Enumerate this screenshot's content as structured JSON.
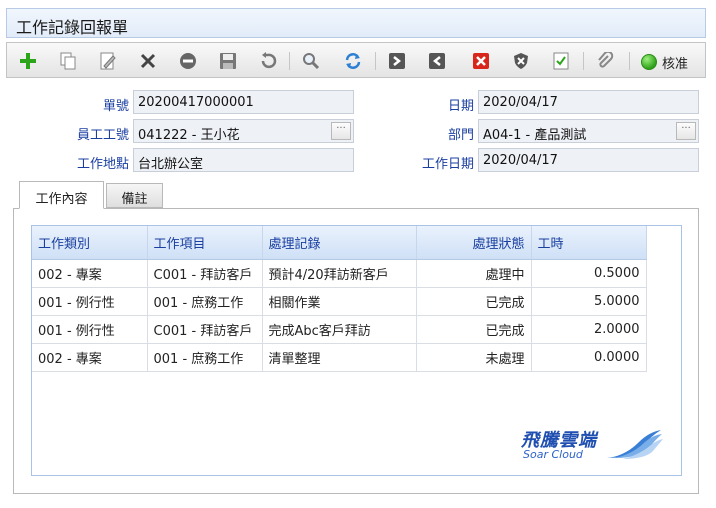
{
  "window": {
    "title": "工作記錄回報單"
  },
  "toolbar": {
    "icons": [
      "add-icon",
      "copy-icon",
      "edit-icon",
      "delete-icon",
      "cancel-icon",
      "save-icon",
      "undo-icon",
      "search-icon",
      "refresh-icon",
      "next-icon",
      "previous-icon",
      "close-icon",
      "shield-icon",
      "checklist-icon",
      "attachment-icon"
    ],
    "approve_label": "核准"
  },
  "form": {
    "doc_no": {
      "label": "單號",
      "value": "20200417000001"
    },
    "date": {
      "label": "日期",
      "value": "2020/04/17"
    },
    "employee": {
      "label": "員工工號",
      "value": "041222 - 王小花"
    },
    "department": {
      "label": "部門",
      "value": "A04-1 - 產品測試"
    },
    "location": {
      "label": "工作地點",
      "value": "台北辦公室"
    },
    "work_date": {
      "label": "工作日期",
      "value": "2020/04/17"
    },
    "lookup_glyph": "···"
  },
  "tabs": [
    {
      "label": "工作內容",
      "active": true
    },
    {
      "label": "備註",
      "active": false
    }
  ],
  "grid": {
    "headers": [
      "工作類別",
      "工作項目",
      "處理記錄",
      "處理狀態",
      "工時"
    ],
    "rows": [
      [
        "002 - 專案",
        "C001 - 拜訪客戶",
        "預計4/20拜訪新客戶",
        "處理中",
        "0.5000"
      ],
      [
        "001 - 例行性",
        "001 - 庶務工作",
        "相關作業",
        "已完成",
        "5.0000"
      ],
      [
        "001 - 例行性",
        "C001 - 拜訪客戶",
        "完成Abc客戶拜訪",
        "已完成",
        "2.0000"
      ],
      [
        "002 - 專案",
        "001 - 庶務工作",
        "清單整理",
        "未處理",
        "0.0000"
      ]
    ]
  },
  "logo": {
    "zh": "飛騰雲端",
    "en": "Soar Cloud"
  },
  "colors": {
    "label_blue": "#1a3fa0",
    "header_bg": "#cfe0f6",
    "field_bg": "#eef1f6",
    "approve_green": "#2fa21a"
  }
}
